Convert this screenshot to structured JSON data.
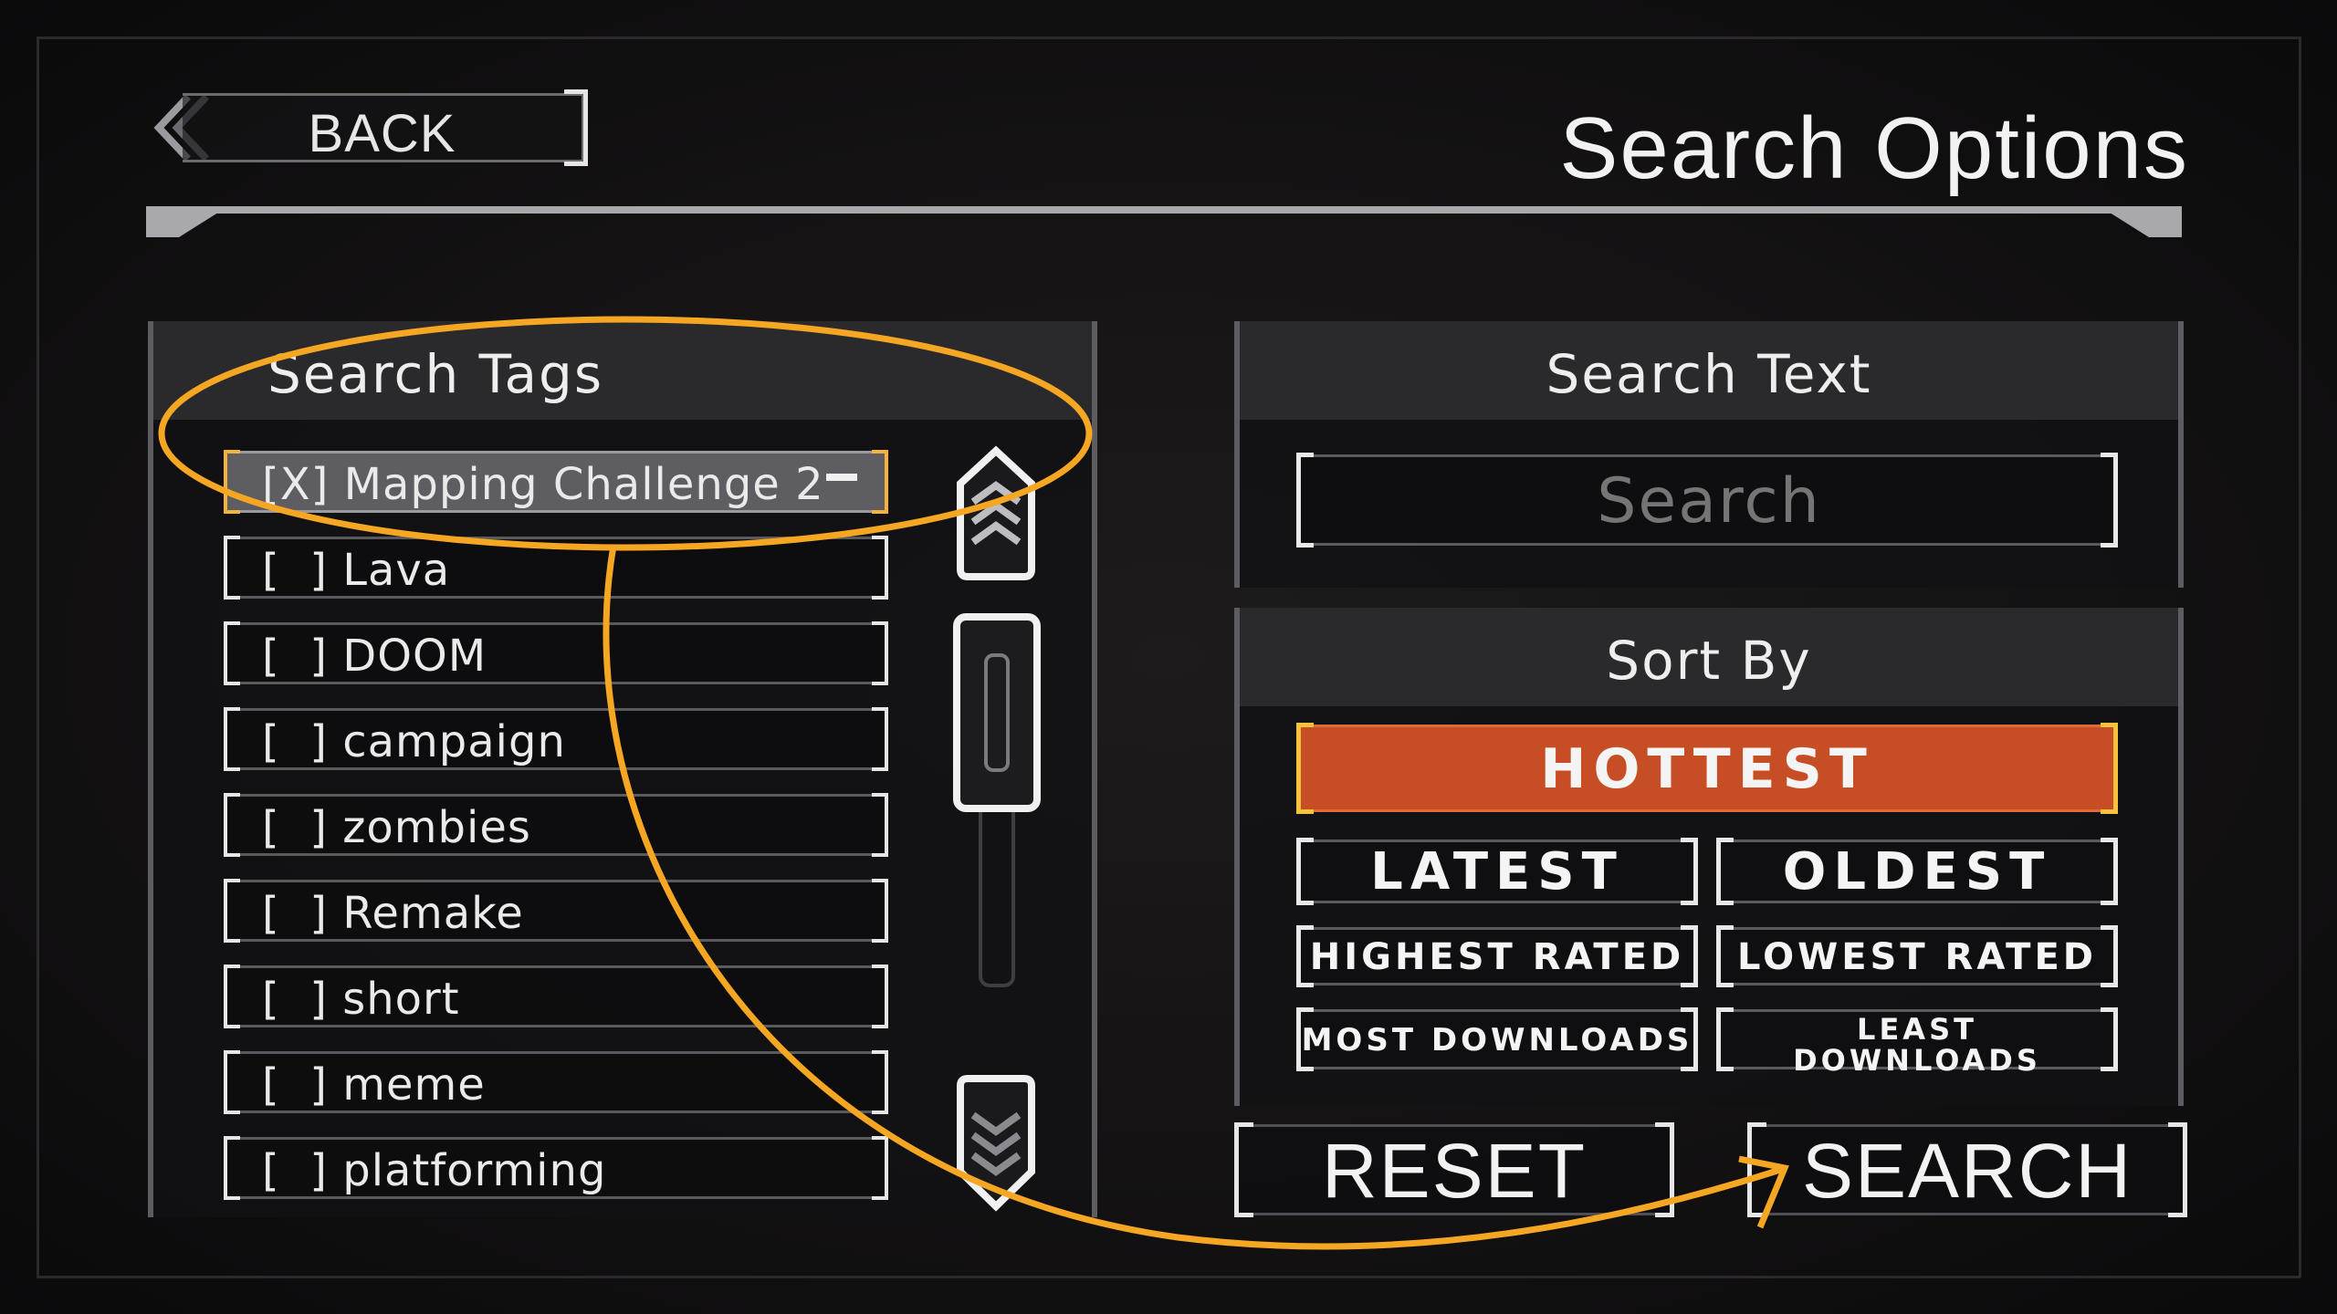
{
  "header": {
    "back_label": "BACK",
    "title": "Search Options"
  },
  "tags_panel": {
    "title": "Search Tags",
    "items": [
      {
        "label": "[X] Mapping Challenge 2",
        "selected": true
      },
      {
        "label": "[  ] Lava",
        "selected": false
      },
      {
        "label": "[  ] DOOM",
        "selected": false
      },
      {
        "label": "[  ] campaign",
        "selected": false
      },
      {
        "label": "[  ] zombies",
        "selected": false
      },
      {
        "label": "[  ] Remake",
        "selected": false
      },
      {
        "label": "[  ] short",
        "selected": false
      },
      {
        "label": "[  ] meme",
        "selected": false
      },
      {
        "label": "[  ] platforming",
        "selected": false
      }
    ]
  },
  "text_panel": {
    "title": "Search Text",
    "placeholder": "Search"
  },
  "sort_panel": {
    "title": "Sort By",
    "options": {
      "hottest": "HOTTEST",
      "latest": "LATEST",
      "oldest": "OLDEST",
      "highest_rated": "HIGHEST RATED",
      "lowest_rated": "LOWEST RATED",
      "most_downloads": "MOST DOWNLOADS",
      "least_downloads": "LEAST DOWNLOADS"
    },
    "active": "hottest"
  },
  "actions": {
    "reset_label": "RESET",
    "search_label": "SEARCH"
  },
  "colors": {
    "accent_orange": "#c74d24",
    "bracket_gold": "#f2b53a",
    "annotation": "#f5a623"
  }
}
